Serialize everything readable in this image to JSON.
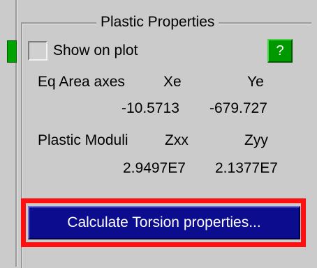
{
  "panel": {
    "title": "Plastic Properties",
    "show_on_plot_label": "Show on plot",
    "help_label": "?"
  },
  "eq_area_axes": {
    "label": "Eq Area axes",
    "col1_header": "Xe",
    "col2_header": "Ye",
    "xe_value": "-10.5713",
    "ye_value": "-679.727"
  },
  "plastic_moduli": {
    "label": "Plastic Moduli",
    "col1_header": "Zxx",
    "col2_header": "Zyy",
    "zxx_value": "2.9497E7",
    "zyy_value": "2.1377E7"
  },
  "actions": {
    "calculate_torsion_label": "Calculate Torsion properties..."
  },
  "colors": {
    "background": "#cbcbcb",
    "help_green": "#009a00",
    "primary_button": "#0c0c8e",
    "highlight_red": "#ff1010"
  }
}
